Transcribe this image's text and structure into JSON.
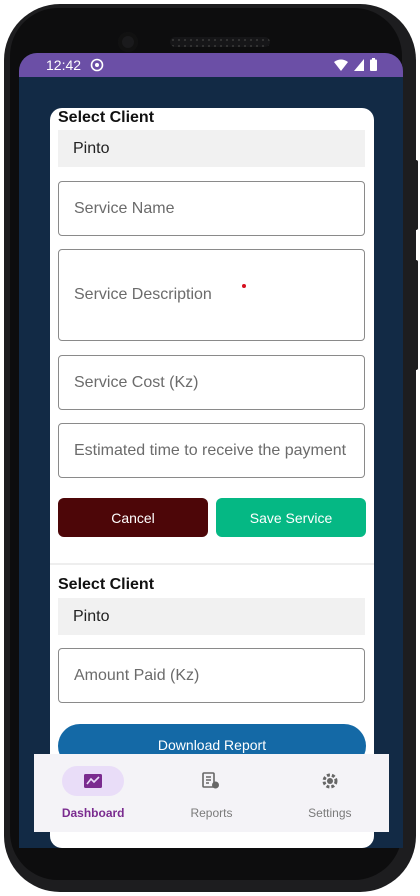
{
  "status_bar": {
    "time": "12:42"
  },
  "service_form": {
    "title": "Select Client",
    "client_selected": "Pinto",
    "service_name_placeholder": "Service Name",
    "service_description_placeholder": "Service Description",
    "service_cost_placeholder": "Service Cost (Kz)",
    "estimated_time_placeholder": "Estimated time to receive the payment",
    "cancel_label": "Cancel",
    "save_label": "Save Service"
  },
  "payment_form": {
    "title": "Select Client",
    "client_selected": "Pinto",
    "amount_paid_placeholder": "Amount Paid (Kz)",
    "download_label": "Download Report"
  },
  "bottom_nav": {
    "items": [
      {
        "label": "Dashboard",
        "icon": "dashboard-icon",
        "active": true
      },
      {
        "label": "Reports",
        "icon": "reports-icon",
        "active": false
      },
      {
        "label": "Settings",
        "icon": "settings-icon",
        "active": false
      }
    ]
  },
  "colors": {
    "status_bar": "#6b4fa6",
    "background": "#122a45",
    "cancel": "#4d0608",
    "save": "#05b884",
    "download": "#1469a6",
    "nav_active": "#7a2b8f"
  }
}
